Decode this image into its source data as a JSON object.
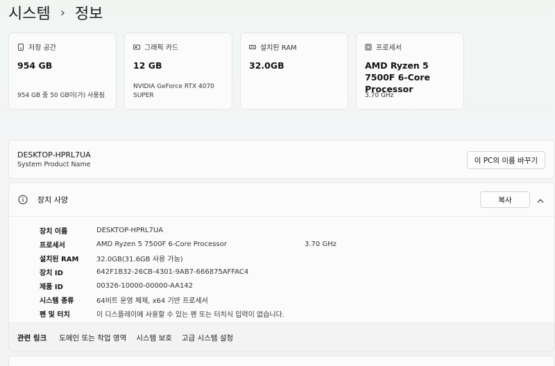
{
  "breadcrumb": {
    "parent": "시스템",
    "separator": "›",
    "current": "정보"
  },
  "cards": [
    {
      "icon": "storage-icon",
      "label": "저장 공간",
      "value": "954 GB",
      "sub": "954 GB 중 50 GB이(가) 사용됨"
    },
    {
      "icon": "graphics-card-icon",
      "label": "그래픽 카드",
      "value": "12 GB",
      "sub": "NVIDIA GeForce RTX 4070 SUPER"
    },
    {
      "icon": "ram-icon",
      "label": "설치된 RAM",
      "value": "32.0GB",
      "sub": ""
    },
    {
      "icon": "processor-icon",
      "label": "프로세서",
      "value": "AMD Ryzen 5 7500F 6-Core Processor",
      "sub": "3.70 GHz"
    }
  ],
  "device": {
    "name": "DESKTOP-HPRL7UA",
    "sub": "System Product Name",
    "rename_label": "이 PC의 이름 바꾸기"
  },
  "specs": {
    "title": "장치 사양",
    "copy_label": "복사",
    "rows": [
      {
        "key": "장치 이름",
        "value": "DESKTOP-HPRL7UA",
        "extra": ""
      },
      {
        "key": "프로세서",
        "value": "AMD Ryzen 5 7500F 6-Core Processor",
        "extra": "3.70 GHz"
      },
      {
        "key": "설치된 RAM",
        "value": "32.0GB(31.6GB 사용 가능)",
        "extra": ""
      },
      {
        "key": "장치 ID",
        "value": "642F1B32-26CB-4301-9AB7-666875AFFAC4",
        "extra": ""
      },
      {
        "key": "제품 ID",
        "value": "00326-10000-00000-AA142",
        "extra": ""
      },
      {
        "key": "시스템 종류",
        "value": "64비트 운영 체제, x64 기반 프로세서",
        "extra": ""
      },
      {
        "key": "펜 및 터치",
        "value": "이 디스플레이에 사용할 수 있는 펜 또는 터치식 입력이 없습니다.",
        "extra": ""
      }
    ]
  },
  "related": {
    "label": "관련 링크",
    "links": [
      "도메인 또는 작업 영역",
      "시스템 보호",
      "고급 시스템 설정"
    ]
  }
}
